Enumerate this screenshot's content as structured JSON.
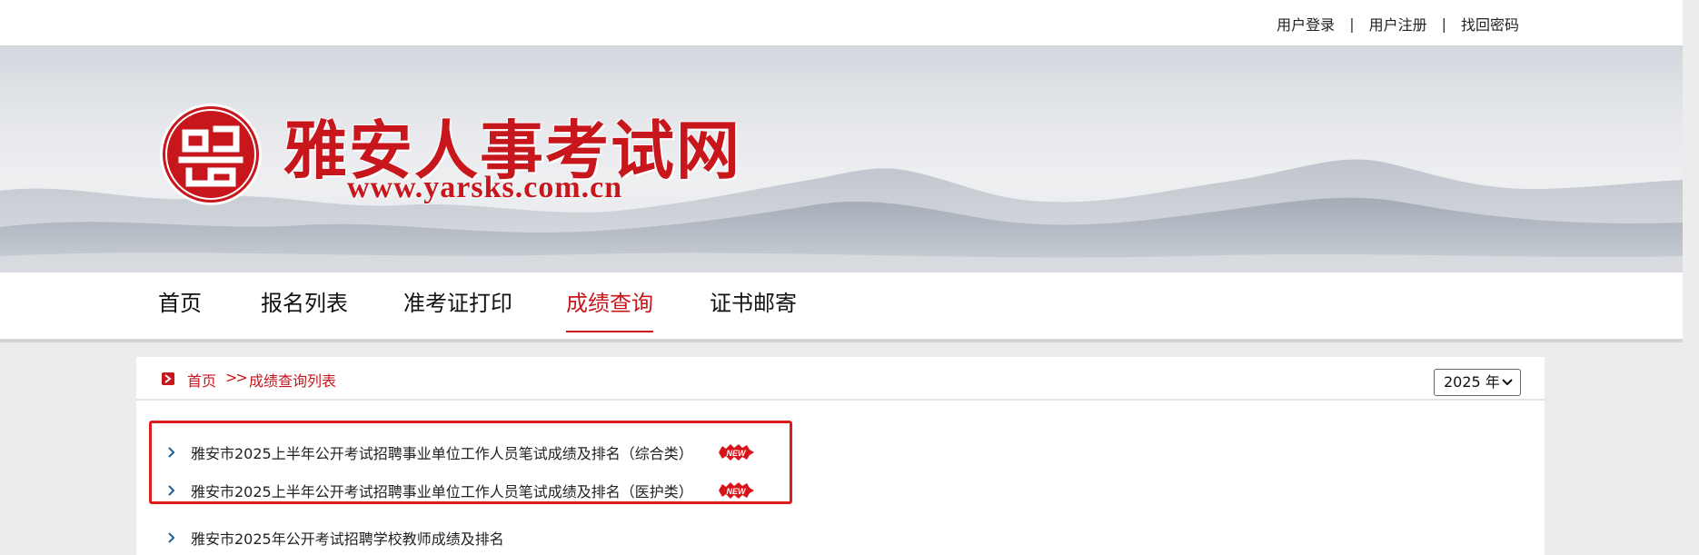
{
  "header": {
    "links": [
      {
        "label": "用户登录"
      },
      {
        "label": "用户注册"
      },
      {
        "label": "找回密码"
      }
    ],
    "separator": "|"
  },
  "banner": {
    "site_title": "雅安人事考试网",
    "site_url": "www.yarsks.com.cn",
    "seal_icon": "seal-logo-icon"
  },
  "nav": {
    "items": [
      {
        "label": "首页"
      },
      {
        "label": "报名列表"
      },
      {
        "label": "准考证打印"
      },
      {
        "label": "成绩查询"
      },
      {
        "label": "证书邮寄"
      }
    ],
    "active_index": 3
  },
  "breadcrumb": {
    "home": "首页",
    "separator": ">>",
    "current": "成绩查询列表"
  },
  "year_filter": {
    "selected": "2025 年"
  },
  "results": [
    {
      "title": "雅安市2025上半年公开考试招聘事业单位工作人员笔试成绩及排名（综合类）",
      "is_new": true,
      "highlighted": true
    },
    {
      "title": "雅安市2025上半年公开考试招聘事业单位工作人员笔试成绩及排名（医护类）",
      "is_new": true,
      "highlighted": true
    },
    {
      "title": "雅安市2025年公开考试招聘学校教师成绩及排名",
      "is_new": false,
      "highlighted": false
    }
  ],
  "badge": {
    "label": "NEW"
  },
  "colors": {
    "accent": "#c8161d",
    "highlight_border": "#e01b1b",
    "page_bg": "#ececec"
  }
}
